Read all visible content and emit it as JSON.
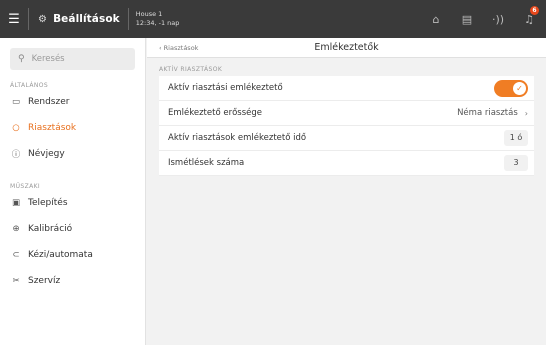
{
  "topbar": {
    "menu_icon": "hamburger-icon",
    "title": "Beállítások",
    "title_icon": "gear-icon",
    "house_name": "House 1",
    "house_time": "12:34, -1 nap",
    "icons": [
      "home-icon",
      "document-icon",
      "signal-icon",
      "bell-icon"
    ],
    "notification_count": "6",
    "accent_color": "#e8481c"
  },
  "sidebar": {
    "search_placeholder": "Keresés",
    "section_general": "ÁLTALÁNOS",
    "section_technical": "MŰSZAKI",
    "items_general": [
      {
        "label": "Rendszer",
        "icon": "display-icon"
      },
      {
        "label": "Riasztások",
        "icon": "alert-ring-icon",
        "active": true
      },
      {
        "label": "Névjegy",
        "icon": "info-icon"
      }
    ],
    "items_technical": [
      {
        "label": "Telepítés",
        "icon": "install-icon"
      },
      {
        "label": "Kalibráció",
        "icon": "calibrate-icon"
      },
      {
        "label": "Kézi/automata",
        "icon": "toggle-icon"
      },
      {
        "label": "Szervíz",
        "icon": "tools-icon"
      }
    ],
    "active_color": "#e8701e"
  },
  "main": {
    "back_label": "‹  Riasztások",
    "title": "Emlékeztetők",
    "group_label": "AKTÍV RIASZTÁSOK",
    "rows": [
      {
        "label": "Aktív riasztási emlékeztető",
        "type": "toggle",
        "on": true
      },
      {
        "label": "Emlékeztető erőssége",
        "value": "Néma riasztás"
      },
      {
        "label": "Aktív riasztások emlékeztető idő",
        "value": "1 ó"
      },
      {
        "label": "Ismétlések száma",
        "value": "3"
      }
    ],
    "toggle_color": "#f07d24"
  }
}
